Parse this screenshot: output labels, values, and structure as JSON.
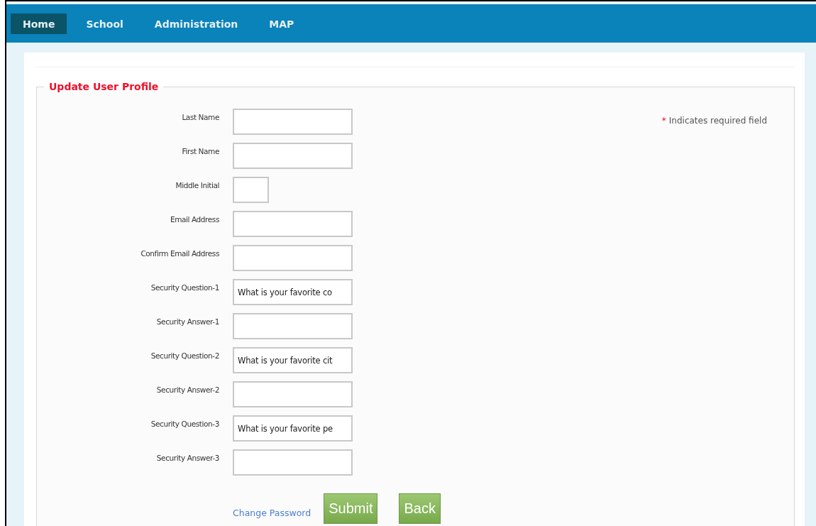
{
  "nav": {
    "items": [
      {
        "label": "Home",
        "selected": true
      },
      {
        "label": "School",
        "selected": false
      },
      {
        "label": "Administration",
        "selected": false
      },
      {
        "label": "MAP",
        "selected": false
      }
    ]
  },
  "form": {
    "legend": "Update User Profile",
    "required_note": {
      "mark": "*",
      "text": "Indicates required field"
    },
    "fields": [
      {
        "label": "Last Name",
        "kind": "wide"
      },
      {
        "label": "First Name",
        "kind": "wide"
      },
      {
        "label": "Middle Initial",
        "kind": "short"
      },
      {
        "label": "Email Address",
        "kind": "wide"
      },
      {
        "label": "Confirm Email Address",
        "kind": "wide"
      },
      {
        "label": "Security Question-1",
        "kind": "wide",
        "value": "What is your favorite co"
      },
      {
        "label": "Security Answer-1",
        "kind": "wide"
      },
      {
        "label": "Security Question-2",
        "kind": "wide",
        "value": "What is your favorite cit"
      },
      {
        "label": "Security Answer-2",
        "kind": "wide"
      },
      {
        "label": "Security Question-3",
        "kind": "wide",
        "value": "What is your favorite pe"
      },
      {
        "label": "Security Answer-3",
        "kind": "wide"
      }
    ],
    "link": "Change Password",
    "buttons": [
      "Submit",
      "Back"
    ]
  }
}
